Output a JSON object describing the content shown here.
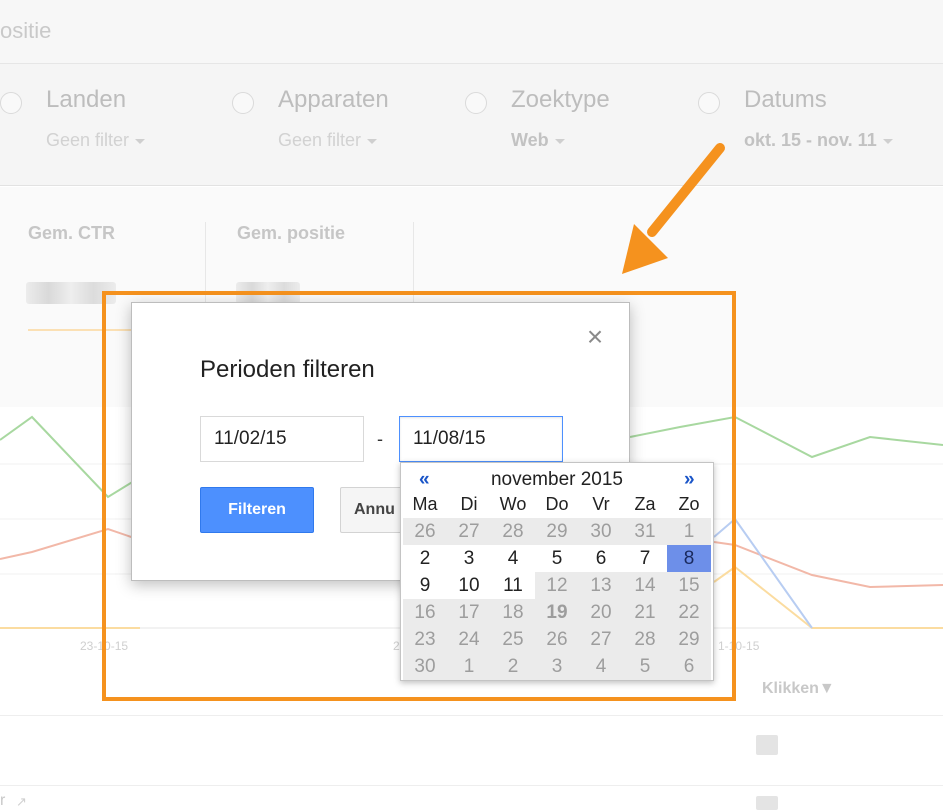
{
  "header": {
    "title_partial": "ositie"
  },
  "filters": [
    {
      "label": "Landen",
      "value": "Geen filter",
      "strong": false
    },
    {
      "label": "Apparaten",
      "value": "Geen filter",
      "strong": false
    },
    {
      "label": "Zoektype",
      "value": "Web",
      "strong": true
    },
    {
      "label": "Datums",
      "value": "okt. 15 - nov. 11",
      "strong": true
    }
  ],
  "metrics": [
    {
      "label": "Gem. CTR"
    },
    {
      "label": "Gem. positie"
    }
  ],
  "chart": {
    "x_tick_1": "23-10-15",
    "x_tick_2": "2",
    "x_tick_3": "1-10-15",
    "colors": {
      "green": "#a8d8a0",
      "red": "#f2b8a8",
      "yellow": "#fbdca0",
      "blue": "#b8cdf2"
    }
  },
  "table": {
    "column_clicks": "Klikken",
    "sort_glyph": "▼",
    "partial_row": "r"
  },
  "dialog": {
    "title": "Perioden filteren",
    "start_date": "11/02/15",
    "end_date": "11/08/15",
    "dash": "-",
    "filter_button": "Filteren",
    "cancel_button": "Annu",
    "close_glyph": "×"
  },
  "calendar": {
    "prev": "«",
    "next": "»",
    "month_label": "november 2015",
    "weekdays": [
      "Ma",
      "Di",
      "Wo",
      "Do",
      "Vr",
      "Za",
      "Zo"
    ],
    "weeks": [
      [
        {
          "d": "26",
          "s": "other"
        },
        {
          "d": "27",
          "s": "other"
        },
        {
          "d": "28",
          "s": "other"
        },
        {
          "d": "29",
          "s": "other"
        },
        {
          "d": "30",
          "s": "other"
        },
        {
          "d": "31",
          "s": "other"
        },
        {
          "d": "1",
          "s": "out"
        }
      ],
      [
        {
          "d": "2",
          "s": "in"
        },
        {
          "d": "3",
          "s": "in"
        },
        {
          "d": "4",
          "s": "in"
        },
        {
          "d": "5",
          "s": "in"
        },
        {
          "d": "6",
          "s": "in"
        },
        {
          "d": "7",
          "s": "in"
        },
        {
          "d": "8",
          "s": "selected"
        }
      ],
      [
        {
          "d": "9",
          "s": "in"
        },
        {
          "d": "10",
          "s": "in"
        },
        {
          "d": "11",
          "s": "in"
        },
        {
          "d": "12",
          "s": "out"
        },
        {
          "d": "13",
          "s": "out"
        },
        {
          "d": "14",
          "s": "out"
        },
        {
          "d": "15",
          "s": "out"
        }
      ],
      [
        {
          "d": "16",
          "s": "out"
        },
        {
          "d": "17",
          "s": "out"
        },
        {
          "d": "18",
          "s": "out"
        },
        {
          "d": "19",
          "s": "today"
        },
        {
          "d": "20",
          "s": "out"
        },
        {
          "d": "21",
          "s": "out"
        },
        {
          "d": "22",
          "s": "out"
        }
      ],
      [
        {
          "d": "23",
          "s": "out"
        },
        {
          "d": "24",
          "s": "out"
        },
        {
          "d": "25",
          "s": "out"
        },
        {
          "d": "26",
          "s": "out"
        },
        {
          "d": "27",
          "s": "out"
        },
        {
          "d": "28",
          "s": "out"
        },
        {
          "d": "29",
          "s": "out"
        }
      ],
      [
        {
          "d": "30",
          "s": "other"
        },
        {
          "d": "1",
          "s": "other"
        },
        {
          "d": "2",
          "s": "other"
        },
        {
          "d": "3",
          "s": "other"
        },
        {
          "d": "4",
          "s": "other"
        },
        {
          "d": "5",
          "s": "other"
        },
        {
          "d": "6",
          "s": "other"
        }
      ]
    ]
  },
  "annotation": {
    "highlight_color": "#f5921e"
  }
}
